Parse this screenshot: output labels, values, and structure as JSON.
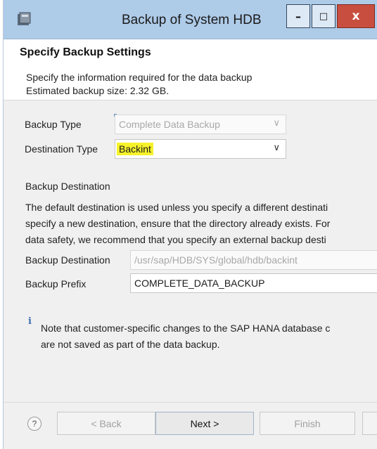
{
  "window": {
    "title": "Backup of System HDB",
    "min_glyph": "–",
    "max_glyph": "□",
    "close_glyph": "x"
  },
  "header": {
    "title": "Specify Backup Settings",
    "line1": "Specify the information required for the data backup",
    "line2": "Estimated backup size: 2.32 GB."
  },
  "form": {
    "backup_type_label": "Backup Type",
    "backup_type_value": "Complete Data Backup",
    "destination_type_label": "Destination Type",
    "destination_type_value": "Backint",
    "highlight_color": "#f6f22a"
  },
  "destination": {
    "section_label": "Backup Destination",
    "text_lines": [
      "The default destination is used unless you specify a different destinati",
      "specify a new destination, ensure that the directory already exists. For",
      "data safety, we recommend that you specify an external backup desti"
    ],
    "backup_destination_label": "Backup Destination",
    "backup_destination_value": "/usr/sap/HDB/SYS/global/hdb/backint",
    "backup_prefix_label": "Backup Prefix",
    "backup_prefix_value": "COMPLETE_DATA_BACKUP"
  },
  "note": {
    "icon": "i",
    "line1": "Note that customer-specific changes to the SAP HANA database c",
    "line2": "are not saved as part of the data backup."
  },
  "footer": {
    "help_glyph": "?",
    "back_label": "< Back",
    "next_label": "Next >",
    "finish_label": "Finish"
  },
  "colors": {
    "titlebar": "#aecbe8",
    "close": "#c84f3f"
  }
}
